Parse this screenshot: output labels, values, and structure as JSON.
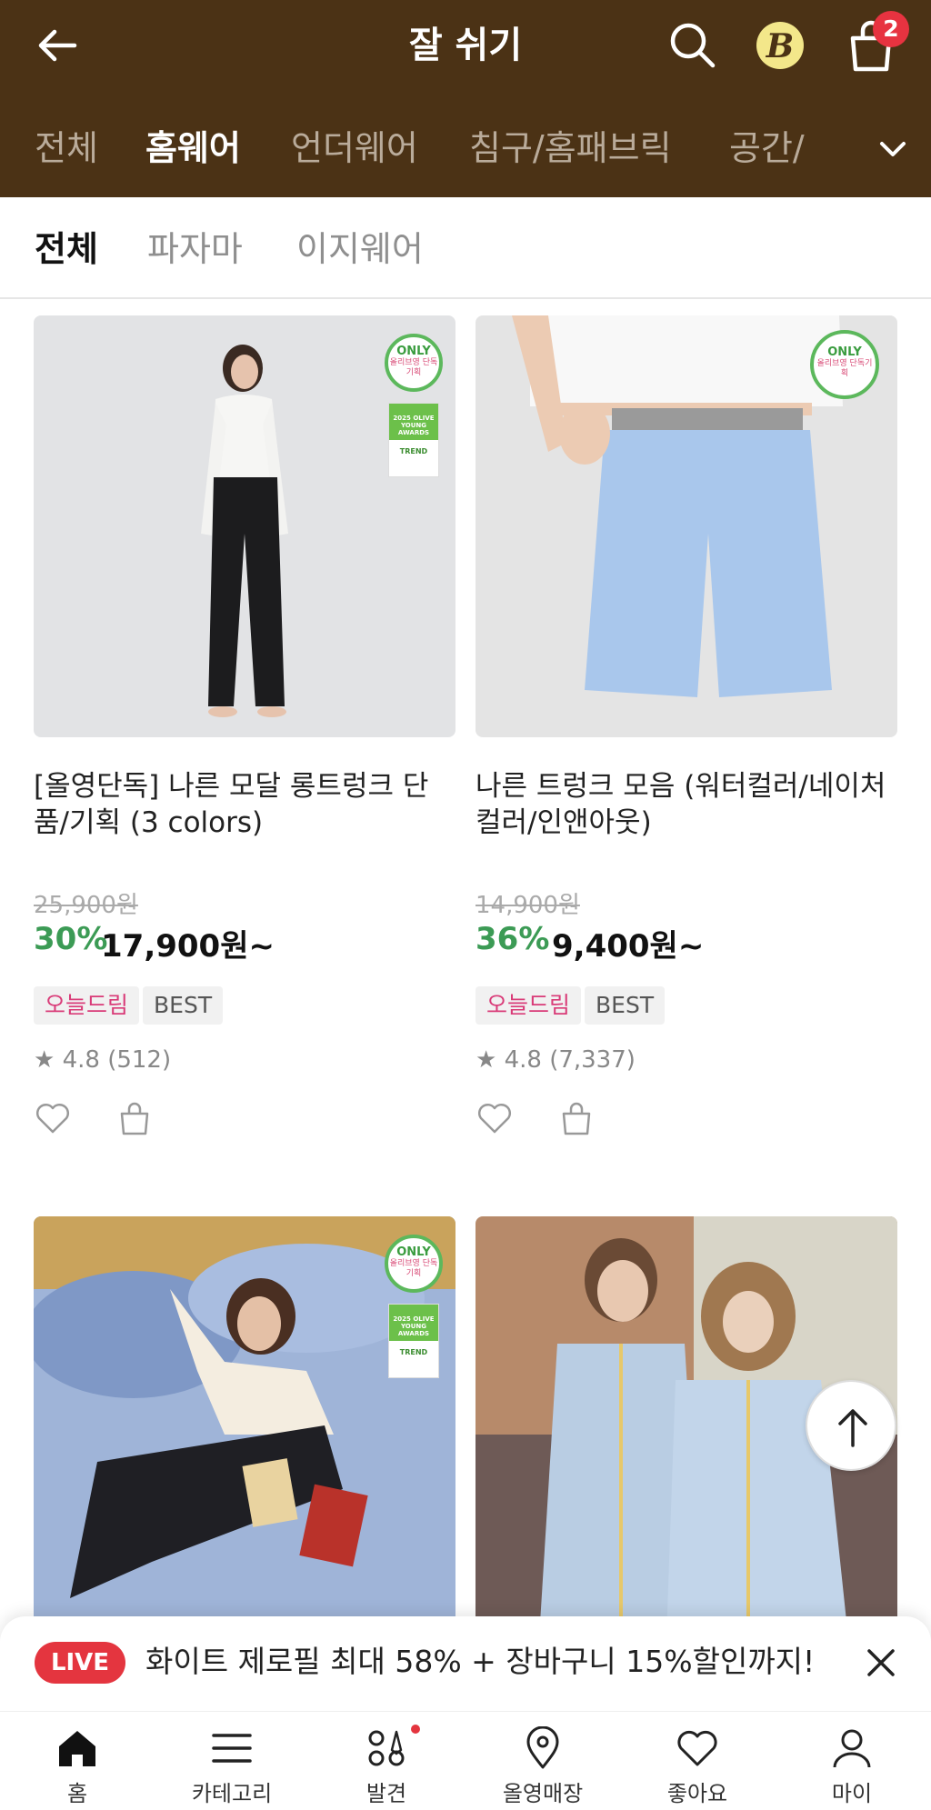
{
  "header": {
    "title": "잘 쉬기",
    "cart_count": "2",
    "points_badge": "B"
  },
  "category_tabs": [
    {
      "label": "전체",
      "active": false
    },
    {
      "label": "홈웨어",
      "active": true
    },
    {
      "label": "언더웨어",
      "active": false
    },
    {
      "label": "침구/홈패브릭",
      "active": false
    },
    {
      "label": "공간/",
      "active": false
    }
  ],
  "sub_tabs": [
    {
      "label": "전체",
      "active": true
    },
    {
      "label": "파자마",
      "active": false
    },
    {
      "label": "이지웨어",
      "active": false
    }
  ],
  "products": [
    {
      "name": "[올영단독] 나른 모달 롱트렁크 단품/기획 (3 colors)",
      "original_price": "25,900원",
      "discount": "30%",
      "price": "17,900원~",
      "tags": [
        "오늘드림",
        "BEST"
      ],
      "rating": "4.8 (512)",
      "badge_only": "ONLY",
      "badge_only_sub": "올리브영 단독기획",
      "badge_award": "2025 OLIVE YOUNG AWARDS",
      "badge_award_sub": "TREND"
    },
    {
      "name": "나른 트렁크 모음 (워터컬러/네이처컬러/인앤아웃)",
      "original_price": "14,900원",
      "discount": "36%",
      "price": "9,400원~",
      "tags": [
        "오늘드림",
        "BEST"
      ],
      "rating": "4.8 (7,337)",
      "badge_only": "ONLY",
      "badge_only_sub": "올리브영 단독기획"
    },
    {
      "badge_only": "ONLY",
      "badge_only_sub": "올리브영 단독기획",
      "badge_award": "2025 OLIVE YOUNG AWARDS",
      "badge_award_sub": "TREND"
    },
    {}
  ],
  "live_banner": {
    "pill": "LIVE",
    "text": "화이트 제로필 최대 58% + 장바구니 15%할인까지!"
  },
  "bottom_nav": [
    {
      "label": "홈",
      "icon": "home-icon"
    },
    {
      "label": "카테고리",
      "icon": "menu-icon"
    },
    {
      "label": "발견",
      "icon": "discover-icon"
    },
    {
      "label": "올영매장",
      "icon": "location-pin-icon"
    },
    {
      "label": "좋아요",
      "icon": "heart-icon"
    },
    {
      "label": "마이",
      "icon": "person-icon"
    }
  ],
  "colors": {
    "header_bg": "#4b3215",
    "discount_green": "#3c9b55",
    "live_red": "#e4353f",
    "tag_pink": "#d93b78"
  }
}
